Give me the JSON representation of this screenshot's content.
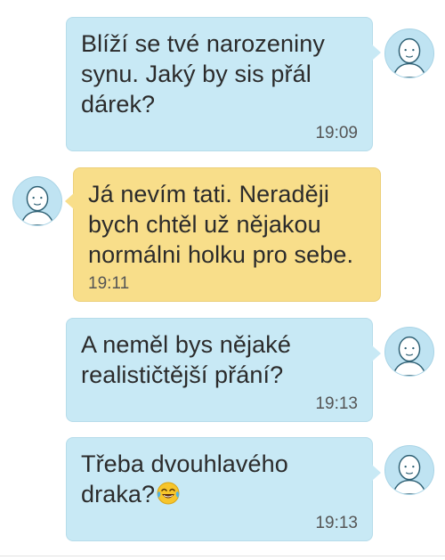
{
  "messages": [
    {
      "direction": "outgoing",
      "text": "Blíží se tvé narozeniny\nsynu. Jaký by sis přál\ndárek?",
      "time": "19:09"
    },
    {
      "direction": "incoming",
      "text": "Já nevím tati. Neraději\nbych chtěl už nějakou\nnormálni holku pro sebe.",
      "time": "19:11"
    },
    {
      "direction": "outgoing",
      "text": "A neměl bys nějaké\nrealističtější přání?",
      "time": "19:13"
    },
    {
      "direction": "outgoing",
      "text": "Třeba dvouhlavého\ndraka?",
      "time": "19:13",
      "emoji": "laughing-tears-emoji"
    }
  ],
  "colors": {
    "outgoing_bubble": "#c8e9f5",
    "incoming_bubble": "#f8de8a",
    "avatar": "#bfe3f2",
    "timestamp": "#555555"
  },
  "icons": {
    "avatar": "default-user-avatar-icon"
  }
}
